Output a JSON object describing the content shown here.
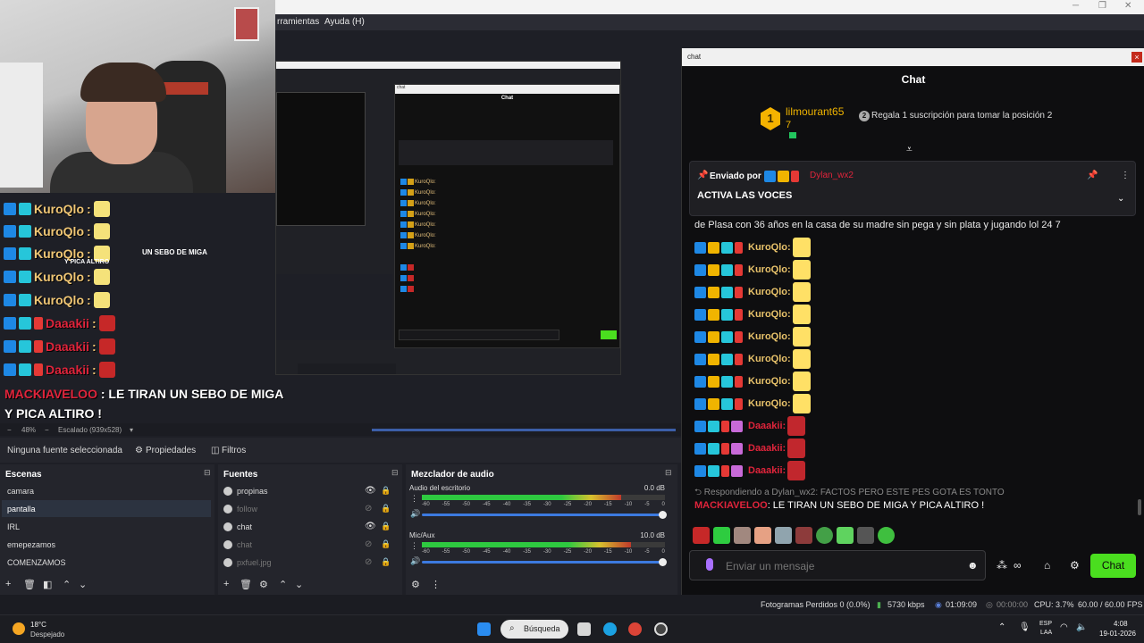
{
  "obs": {
    "menu": [
      "rramientas",
      "Ayuda (H)"
    ],
    "scale_label": "Escalado (939x528)",
    "zoom": "48%",
    "no_source": "Ninguna fuente seleccionada",
    "properties": "Propiedades",
    "filters": "Filtros",
    "scenes": {
      "title": "Escenas",
      "items": [
        "camara",
        "pantalla",
        "IRL",
        "emepezamos",
        "COMENZAMOS"
      ],
      "selected": 1
    },
    "sources": {
      "title": "Fuentes",
      "items": [
        "propinas",
        "follow",
        "chat",
        "chat",
        "pxfuel.jpg"
      ]
    },
    "mixer": {
      "title": "Mezclador de audio",
      "channels": [
        {
          "name": "Audio del escritorio",
          "db": "0.0 dB",
          "level": 0.82
        },
        {
          "name": "Mic/Aux",
          "db": "10.0 dB",
          "level": 0.86
        }
      ],
      "ticks": [
        "-60",
        "-55",
        "-50",
        "-45",
        "-40",
        "-35",
        "-30",
        "-25",
        "-20",
        "-15",
        "-10",
        "-5",
        "0"
      ]
    },
    "status": {
      "dropped": "Fotogramas Perdidos 0 (0.0%)",
      "kbps": "5730 kbps",
      "live_time": "01:09:09",
      "rec_time": "00:00:00",
      "cpu": "CPU: 3.7%",
      "fps": "60.00 / 60.00 FPS"
    }
  },
  "overlay": {
    "rows": [
      {
        "name": "KuroQlo",
        "sep": ":",
        "color": "gold"
      },
      {
        "name": "KuroQlo",
        "sep": ":",
        "color": "gold"
      },
      {
        "name": "KuroQlo",
        "sep": ":",
        "color": "gold"
      },
      {
        "name": "KuroQlo",
        "sep": ":",
        "color": "gold"
      },
      {
        "name": "KuroQlo",
        "sep": ":",
        "color": "gold"
      },
      {
        "name": "Daaakii",
        "sep": ":",
        "color": "red"
      },
      {
        "name": "Daaakii",
        "sep": ":",
        "color": "red"
      },
      {
        "name": "Daaakii",
        "sep": ":",
        "color": "red"
      }
    ],
    "mid_text": "UN SEBO DE MIGA",
    "mid_text2": "Y PICA ALTIRO",
    "msg_name": "MACKIAVELOO",
    "msg_text": " : LE TIRAN UN SEBO DE MIGA",
    "msg_text2": "Y PICA ALTIRO !"
  },
  "mini_chat": {
    "title": "Chat",
    "name": "KuroQlo:"
  },
  "chat": {
    "window_title": "chat",
    "header": "Chat",
    "leader": {
      "rank": "1",
      "name": "lilmourant65",
      "count": "7",
      "gift_rank": "2",
      "gift_text": "Regala 1 suscripción para tomar la posición 2"
    },
    "pinned": {
      "by": "Enviado por",
      "user": "Dylan_wx2",
      "message": "ACTIVA LAS VOCES"
    },
    "partial_line": "de Plasa con 36 años en la casa de su madre sin pega y sin plata y jugando lol 24 7",
    "messages": [
      {
        "name": "KuroQlo:",
        "color": "gold"
      },
      {
        "name": "KuroQlo:",
        "color": "gold"
      },
      {
        "name": "KuroQlo:",
        "color": "gold"
      },
      {
        "name": "KuroQlo:",
        "color": "gold"
      },
      {
        "name": "KuroQlo:",
        "color": "gold"
      },
      {
        "name": "KuroQlo:",
        "color": "gold"
      },
      {
        "name": "KuroQlo:",
        "color": "gold"
      },
      {
        "name": "KuroQlo:",
        "color": "gold"
      },
      {
        "name": "Daaakii:",
        "color": "red"
      },
      {
        "name": "Daaakii:",
        "color": "red"
      },
      {
        "name": "Daaakii:",
        "color": "red"
      }
    ],
    "reply_line": "Respondiendo a Dylan_wx2: FACTOS PERO ESTE PES GOTA ES TONTO",
    "reply_name": "MACKIAVELOO",
    "reply_text": ": LE TIRAN UN SEBO DE MIGA Y PICA ALTIRO !",
    "input_placeholder": "Enviar un mensaje",
    "send_label": "Chat"
  },
  "taskbar": {
    "temp": "18°C",
    "weather": "Despejado",
    "search": "Búsqueda",
    "lang1": "ESP",
    "lang2": "LAA",
    "time": "4:08",
    "date": "19-01-2026"
  }
}
